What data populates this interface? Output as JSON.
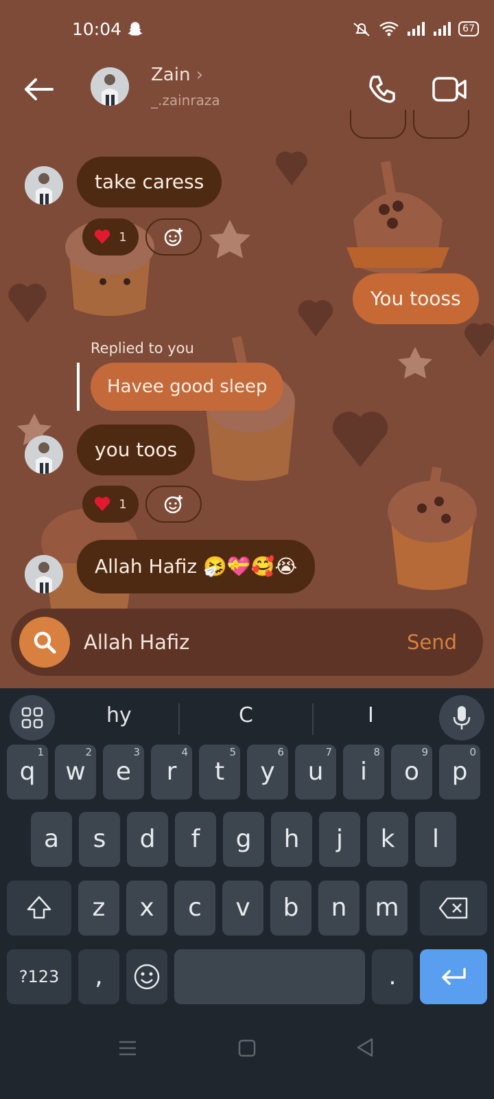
{
  "status_bar": {
    "time": "10:04",
    "battery": "67"
  },
  "header": {
    "name": "Zain",
    "chevron": "›",
    "username": "_.zainraza"
  },
  "messages": {
    "m1": {
      "text": "take caress",
      "reaction_count": "1"
    },
    "m2": {
      "text": "You tooss"
    },
    "reply_label": "Replied to you",
    "reply_quote": "Havee good sleep",
    "m3": {
      "text": "you toos",
      "reaction_count": "1"
    },
    "m4": {
      "text": "Allah Hafiz 🤧💝🥰😭"
    }
  },
  "composer": {
    "value": "Allah Hafiz",
    "send_label": "Send"
  },
  "keyboard": {
    "suggestions": [
      "hy",
      "C",
      "I"
    ],
    "row1": [
      {
        "k": "q",
        "h": "1"
      },
      {
        "k": "w",
        "h": "2"
      },
      {
        "k": "e",
        "h": "3"
      },
      {
        "k": "r",
        "h": "4"
      },
      {
        "k": "t",
        "h": "5"
      },
      {
        "k": "y",
        "h": "6"
      },
      {
        "k": "u",
        "h": "7"
      },
      {
        "k": "i",
        "h": "8"
      },
      {
        "k": "o",
        "h": "9"
      },
      {
        "k": "p",
        "h": "0"
      }
    ],
    "row2": [
      "a",
      "s",
      "d",
      "f",
      "g",
      "h",
      "j",
      "k",
      "l"
    ],
    "row3": [
      "z",
      "x",
      "c",
      "v",
      "b",
      "n",
      "m"
    ],
    "symbols_label": "?123",
    "comma": ",",
    "period": "."
  },
  "colors": {
    "chat_bg": "#7e4b38",
    "bubble_in": "#4e2a12",
    "bubble_out": "#c66935",
    "accent": "#d7803f",
    "enter_key": "#5a9ef0"
  },
  "icons": [
    "snapchat-ghost-icon",
    "mute-icon",
    "wifi-icon",
    "signal-icon",
    "battery-icon",
    "back-arrow-icon",
    "phone-icon",
    "video-icon",
    "heart-icon",
    "add-reaction-icon",
    "search-icon",
    "grid-icon",
    "mic-icon",
    "shift-icon",
    "backspace-icon",
    "emoji-icon",
    "enter-icon",
    "menu-icon",
    "home-icon",
    "back-icon"
  ]
}
